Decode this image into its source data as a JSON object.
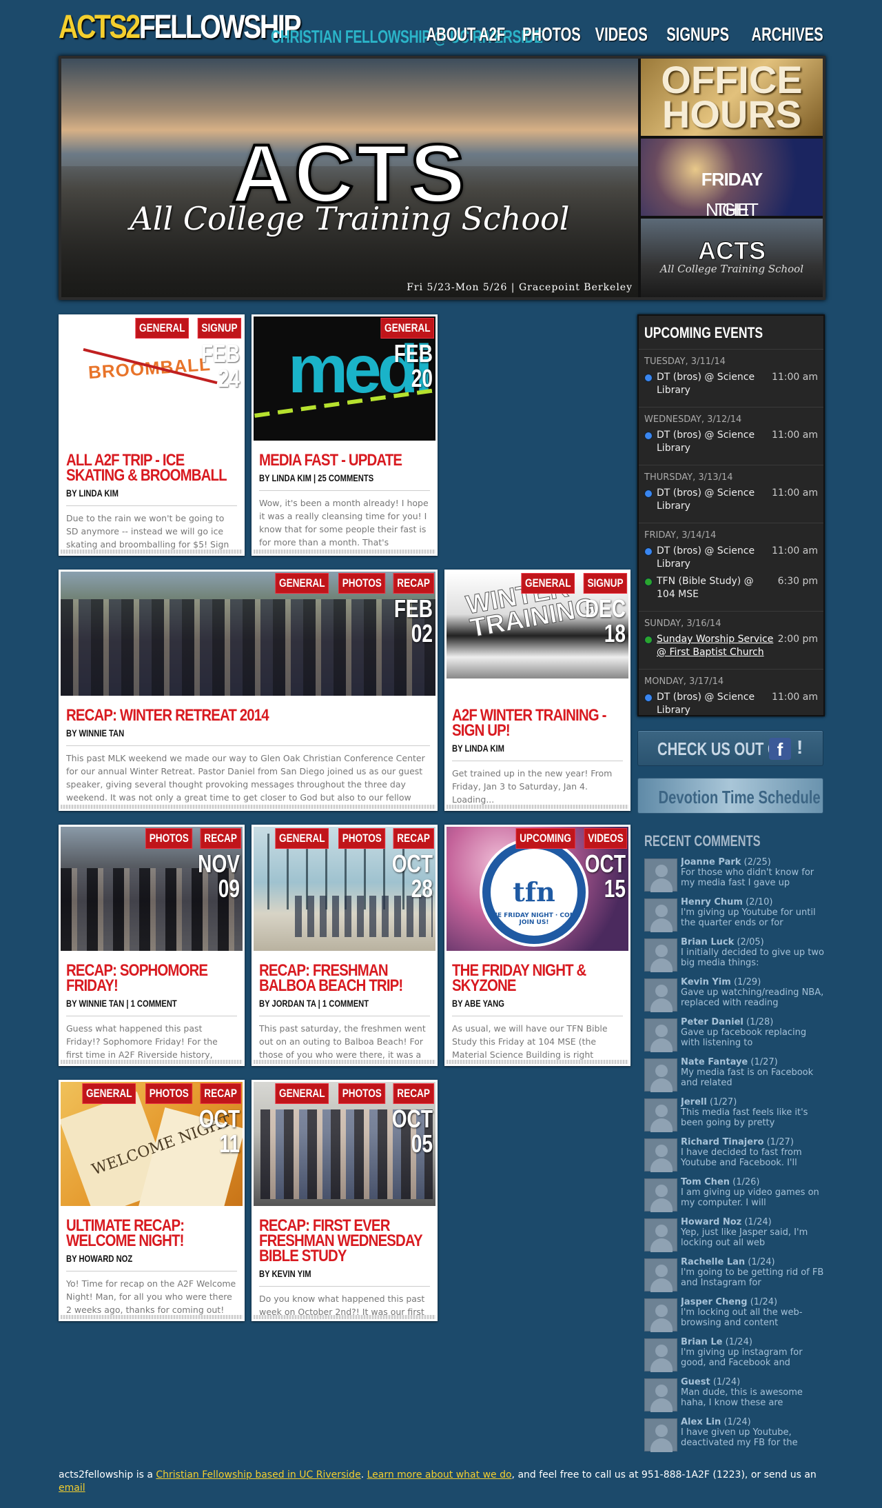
{
  "header": {
    "logo_part1": "ACTS2",
    "logo_part2": "FELLOWSHIP",
    "tagline": "CHRISTIAN FELLOWSHIP @ UC RIVERSIDE",
    "nav": [
      "ABOUT A2F",
      "PHOTOS",
      "VIDEOS",
      "SIGNUPS",
      "ARCHIVES"
    ]
  },
  "hero": {
    "title": "ACTS",
    "subtitle": "All College Training School",
    "date": "Fri 5/23-Mon 5/26 | Gracepoint Berkeley",
    "promos": {
      "office_hours": "OFFICE HOURS",
      "friday_night_pre": "THE",
      "friday_night_bold": "FRIDAY",
      "friday_night_post": "NIGHT",
      "acts_title": "ACTS",
      "acts_sub": "All College Training School"
    }
  },
  "posts": [
    {
      "title": "ALL A2F TRIP - ICE SKATING & BROOMBALL",
      "by": "BY LINDA KIM",
      "tags": [
        "GENERAL",
        "SIGNUP"
      ],
      "month": "FEB",
      "day": "24",
      "excerpt": "Due to the rain we won't be going to SD anymore -- instead we will go ice skating and broomballing for $5! Sign",
      "thumb_text": "BROOMBALL"
    },
    {
      "title": "MEDIA FAST - UPDATE",
      "by": "BY LINDA KIM | 25 COMMENTS",
      "tags": [
        "GENERAL"
      ],
      "month": "FEB",
      "day": "20",
      "excerpt": "Wow, it's been a month already! I hope it was a really cleansing time for you! I know that for some people their fast is for more than a month. That's",
      "thumb_text": "medi"
    },
    {
      "title": "RECAP: WINTER RETREAT 2014",
      "by": "BY WINNIE TAN",
      "tags": [
        "GENERAL",
        "PHOTOS",
        "RECAP"
      ],
      "month": "FEB",
      "day": "02",
      "excerpt": "This past MLK weekend we made our way to Glen Oak Christian Conference Center for our annual Winter Retreat. Pastor Daniel from San Diego joined us as our guest speaker, giving several thought provoking messages throughout the three day weekend. It was not only a great time to get closer to God but also to our fellow"
    },
    {
      "title": "A2F WINTER TRAINING - SIGN UP!",
      "by": "BY LINDA KIM",
      "tags": [
        "GENERAL",
        "SIGNUP"
      ],
      "month": "DEC",
      "day": "18",
      "excerpt": "Get trained up in the new year! From Friday, Jan 3 to Saturday, Jan 4. Loading...",
      "thumb_text": "WINTER TRAINING"
    },
    {
      "title": "RECAP: SOPHOMORE FRIDAY!",
      "by": "BY WINNIE TAN | 1 COMMENT",
      "tags": [
        "PHOTOS",
        "RECAP"
      ],
      "month": "NOV",
      "day": "09",
      "excerpt": "Guess what happened this past Friday!? Sophomore Friday! For the first time in A2F Riverside history, sophomores hosted The Friday Night."
    },
    {
      "title": "RECAP: FRESHMAN BALBOA BEACH TRIP!",
      "by": "BY JORDAN TA | 1 COMMENT",
      "tags": [
        "GENERAL",
        "PHOTOS",
        "RECAP"
      ],
      "month": "OCT",
      "day": "28",
      "excerpt": "This past saturday, the freshmen went out on an outing to Balboa Beach! For those of you who were there, it was a"
    },
    {
      "title": "THE FRIDAY NIGHT & SKYZONE",
      "by": "BY ABE YANG",
      "tags": [
        "UPCOMING",
        "VIDEOS"
      ],
      "month": "OCT",
      "day": "15",
      "excerpt": "As usual, we will have our TFN Bible Study this Friday at 104 MSE (the Material Science Building is right across from AI, and next to Bourns). We'll start",
      "thumb_text": "tfn",
      "thumb_ring": "THE FRIDAY NIGHT · COME JOIN US!"
    },
    {
      "title": "ULTIMATE RECAP: WELCOME NIGHT!",
      "by": "BY HOWARD NOZ",
      "tags": [
        "GENERAL",
        "PHOTOS",
        "RECAP"
      ],
      "month": "OCT",
      "day": "11",
      "excerpt": "Yo! Time for recap on the A2F Welcome Night! Man, for all you who were there 2 weeks ago, thanks for coming out! The",
      "thumb_text": "WELCOME NIGHT"
    },
    {
      "title": "RECAP: FIRST EVER FRESHMAN WEDNESDAY BIBLE STUDY",
      "by": "BY KEVIN YIM",
      "tags": [
        "GENERAL",
        "PHOTOS",
        "RECAP"
      ],
      "month": "OCT",
      "day": "05",
      "excerpt": "Do you know what happened this past week on October 2nd?! It was our first ever freshmen only bible study! We"
    }
  ],
  "events": {
    "heading": "UPCOMING EVENTS",
    "days": [
      {
        "date": "TUESDAY, 3/11/14",
        "items": [
          {
            "name": "DT (bros) @ Science Library",
            "time": "11:00 am",
            "color": "blue"
          }
        ]
      },
      {
        "date": "WEDNESDAY, 3/12/14",
        "items": [
          {
            "name": "DT (bros) @ Science Library",
            "time": "11:00 am",
            "color": "blue"
          }
        ]
      },
      {
        "date": "THURSDAY, 3/13/14",
        "items": [
          {
            "name": "DT (bros) @ Science Library",
            "time": "11:00 am",
            "color": "blue"
          }
        ]
      },
      {
        "date": "FRIDAY, 3/14/14",
        "items": [
          {
            "name": "DT (bros) @ Science Library",
            "time": "11:00 am",
            "color": "blue"
          },
          {
            "name": "TFN (Bible Study) @ 104 MSE",
            "time": "6:30 pm",
            "color": "green"
          }
        ]
      },
      {
        "date": "SUNDAY, 3/16/14",
        "items": [
          {
            "name": "Sunday Worship Service @ First Baptist Church",
            "time": "2:00 pm",
            "color": "green",
            "link": true
          }
        ]
      },
      {
        "date": "MONDAY, 3/17/14",
        "items": [
          {
            "name": "DT (bros) @ Science Library",
            "time": "11:00 am",
            "color": "blue"
          }
        ]
      }
    ]
  },
  "sidebar": {
    "facebook_label": "CHECK US OUT ON",
    "facebook_icon": "f",
    "facebook_excl": "!",
    "devotion_label": "Devotion Time Schedule"
  },
  "comments": {
    "heading": "RECENT COMMENTS",
    "items": [
      {
        "name": "Joanne Park",
        "date": "(2/25)",
        "text": "For those who didn't know for my media fast I gave up"
      },
      {
        "name": "Henry Chum",
        "date": "(2/10)",
        "text": "I'm giving up Youtube for until the quarter ends or for"
      },
      {
        "name": "Brian Luck",
        "date": "(2/05)",
        "text": "I initially decided to give up two big media things:"
      },
      {
        "name": "Kevin Yim",
        "date": "(1/29)",
        "text": "Gave up watching/reading NBA, replaced with reading"
      },
      {
        "name": "Peter Daniel",
        "date": "(1/28)",
        "text": "Gave up facebook replacing with listening to"
      },
      {
        "name": "Nate Fantaye",
        "date": "(1/27)",
        "text": "My media fast is on Facebook and related"
      },
      {
        "name": "Jerell",
        "date": "(1/27)",
        "text": "This media fast feels like it's been going by pretty"
      },
      {
        "name": "Richard Tinajero",
        "date": "(1/27)",
        "text": "I have decided to fast from Youtube and Facebook. I'll"
      },
      {
        "name": "Tom Chen",
        "date": "(1/26)",
        "text": "I am giving up video games on my computer. I will"
      },
      {
        "name": "Howard Noz",
        "date": "(1/24)",
        "text": "Yep, just like Jasper said, I'm locking out all web"
      },
      {
        "name": "Rachelle Lan",
        "date": "(1/24)",
        "text": "I'm going to be getting rid of FB and Instagram for"
      },
      {
        "name": "Jasper Cheng",
        "date": "(1/24)",
        "text": "I'm locking out all the web-browsing and content"
      },
      {
        "name": "Brian Le",
        "date": "(1/24)",
        "text": "I'm giving up instagram for good, and Facebook and"
      },
      {
        "name": "Guest",
        "date": "(1/24)",
        "text": "Man dude, this is awesome haha, I know these are"
      },
      {
        "name": "Alex Lin",
        "date": "(1/24)",
        "text": "I have given up Youtube, deactivated my FB for the"
      }
    ]
  },
  "footer": {
    "t1": "acts2fellowship is a ",
    "link1": "Christian Fellowship based in UC Riverside",
    "t2": ". ",
    "link2": "Learn more about what we do",
    "t3": ", and feel free to call us at 951-888-1A2F (1223), or send us an ",
    "link3": "email"
  }
}
